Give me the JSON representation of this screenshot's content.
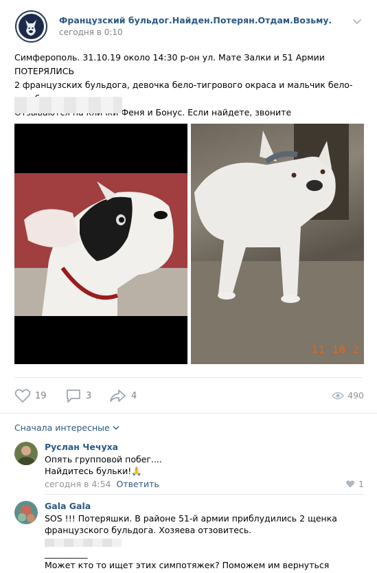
{
  "post": {
    "group_name": "Французский бульдог.Найден.Потерян.Отдам.Возьму.",
    "time": "сегодня в 0:10",
    "text_lines": [
      "Симферополь. 31.10.19 около 14:30 р-он ул. Мате Залки и 51 Армии ПОТЕРЯЛИСЬ",
      "2 французских бульдога, девочка бело-тигрового окраса и мальчик бело-голубого.",
      "Отзываются на клички Феня и Бонус. Если найдете, звоните"
    ],
    "photo_stamp": "11 10 2",
    "likes": "19",
    "comments": "3",
    "shares": "4",
    "views": "490"
  },
  "comments_section": {
    "sort_label": "Сначала интересные",
    "items": [
      {
        "author": "Руслан Чечуха",
        "lines": [
          "Опять групповой побег....",
          "Найдитесь бульки!🙏"
        ],
        "time": "сегодня в 4:54",
        "reply_label": "Ответить",
        "likes": "1"
      },
      {
        "author": "Gala Gala",
        "lines": [
          "SOS !!! Потеряшки. В районе 51-й армии приблудились 2 щенка",
          "французского бульдога. Хозяева отзовитесь.",
          "__________",
          "Может кто то ищет этих симпотяжек? Поможем им вернуться домой!"
        ]
      }
    ]
  },
  "colors": {
    "link": "#2a5885",
    "muted": "#828282",
    "divider": "#e7e8ec",
    "stamp": "#e06a1c"
  },
  "icons": [
    "group-logo",
    "apple-icon",
    "chevron-down-icon",
    "heart-icon",
    "comment-icon",
    "share-icon",
    "eye-icon"
  ]
}
